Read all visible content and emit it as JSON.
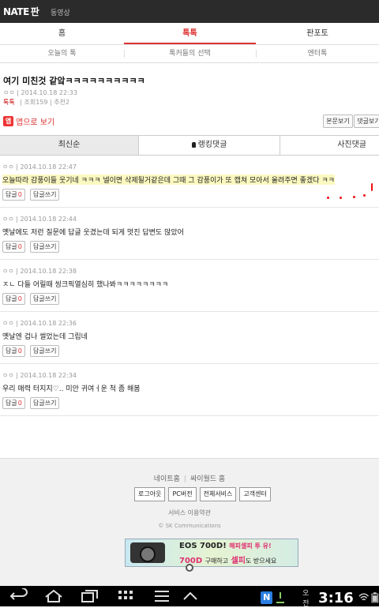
{
  "app": {
    "logo_nate": "NATE",
    "logo_pan": "판",
    "video": "동영상"
  },
  "main_tabs": [
    {
      "label": "홈"
    },
    {
      "label": "톡톡"
    },
    {
      "label": "판포토"
    }
  ],
  "sub_tabs": [
    {
      "label": "오늘의 톡"
    },
    {
      "label": "톡커들의 선택"
    },
    {
      "label": "엔터톡"
    }
  ],
  "post": {
    "title": "여기 미친것 같앜ㅋㅋㅋㅋㅋㅋㅋㅋㅋㅋ",
    "author": "ㅇㅇ",
    "datetime": "2014.10.18 22:33",
    "category": "톡톡",
    "stats": "조회159 | 추천2",
    "app_view": "앱으로 보기",
    "app_icon": "앱",
    "btn_body": "본문보기",
    "btn_comments": "댓글보기"
  },
  "sort_tabs": [
    {
      "label": "최신순"
    },
    {
      "label": "랭킹댓글"
    },
    {
      "label": "사진댓글"
    }
  ],
  "comment_ui": {
    "reply_label": "답글",
    "write_label": "답글쓰기"
  },
  "comments": [
    {
      "author": "ㅇㅇ",
      "datetime": "2014.10.18 22:47",
      "text": "오늘따라 감풍이들 웃기네 ㅋㅋㅋ 넬이면 삭제될거같은데 그때 그 감풍이가 또 캡쳐 모아서 올려주면 좋겠다 ㅋㅋ",
      "replies": "0"
    },
    {
      "author": "ㅇㅇ",
      "datetime": "2014.10.18 22:44",
      "text": "옛날에도 저런 질문에 답글 웃겼는데 되게 멋진 답변도 많았어",
      "replies": "0"
    },
    {
      "author": "ㅇㅇ",
      "datetime": "2014.10.18 22:38",
      "text": "ㅈㄴ 다들 어릴때 씽크픽열심히 했나봐ㅋㅋㅋㅋㅋㅋㅋㅋ",
      "replies": "0"
    },
    {
      "author": "ㅇㅇ",
      "datetime": "2014.10.18 22:36",
      "text": "옛날엔 겁나 썰었는데 그립네",
      "replies": "0"
    },
    {
      "author": "ㅇㅇ",
      "datetime": "2014.10.18 22:34",
      "text": "우리 매력 터지지♡.. 미안 귀여ㅓ운 척 좀 해봄",
      "replies": "0"
    }
  ],
  "footer": {
    "link_natehome": "네이트홈",
    "link_cyworld": "싸이월드 홈",
    "buttons": [
      {
        "label": "로그아웃"
      },
      {
        "label": "PC버전"
      },
      {
        "label": "전체서비스"
      },
      {
        "label": "고객센터"
      }
    ],
    "terms": "서비스 이용약관",
    "copyright": "© SK Communications",
    "ad_line1": "EOS 700D!",
    "ad_line1b": "해피셀피 투 유!",
    "ad_line2a": "700D",
    "ad_line2b": "구매하고",
    "ad_line2c": "셀피",
    "ad_line2d": "도 받으세요"
  },
  "status": {
    "ampm": "오전",
    "time": "3:16",
    "notif": "N"
  },
  "colors": {
    "accent": "#dd3333",
    "topbar": "#2b2b2b",
    "highlight": "#fbf8c0",
    "navbar": "#000000"
  }
}
